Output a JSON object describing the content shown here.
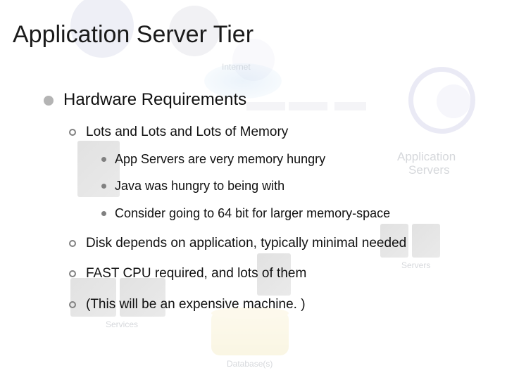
{
  "title": "Application Server Tier",
  "section": "Hardware Requirements",
  "sub1": "Lots and Lots and Lots of Memory",
  "sub1_items": {
    "a": "App Servers are very memory hungry",
    "b": "Java was hungry to being with",
    "c": "Consider going to 64 bit for larger memory-space"
  },
  "sub2": "Disk depends on application, typically minimal needed",
  "sub3": "FAST CPU required, and lots of them",
  "sub4": "(This will be an expensive machine. )",
  "bg": {
    "internet": "Internet",
    "appservers1": "Application",
    "appservers2": "Servers",
    "servers": "Servers",
    "services": "Services",
    "databases": "Database(s)"
  }
}
